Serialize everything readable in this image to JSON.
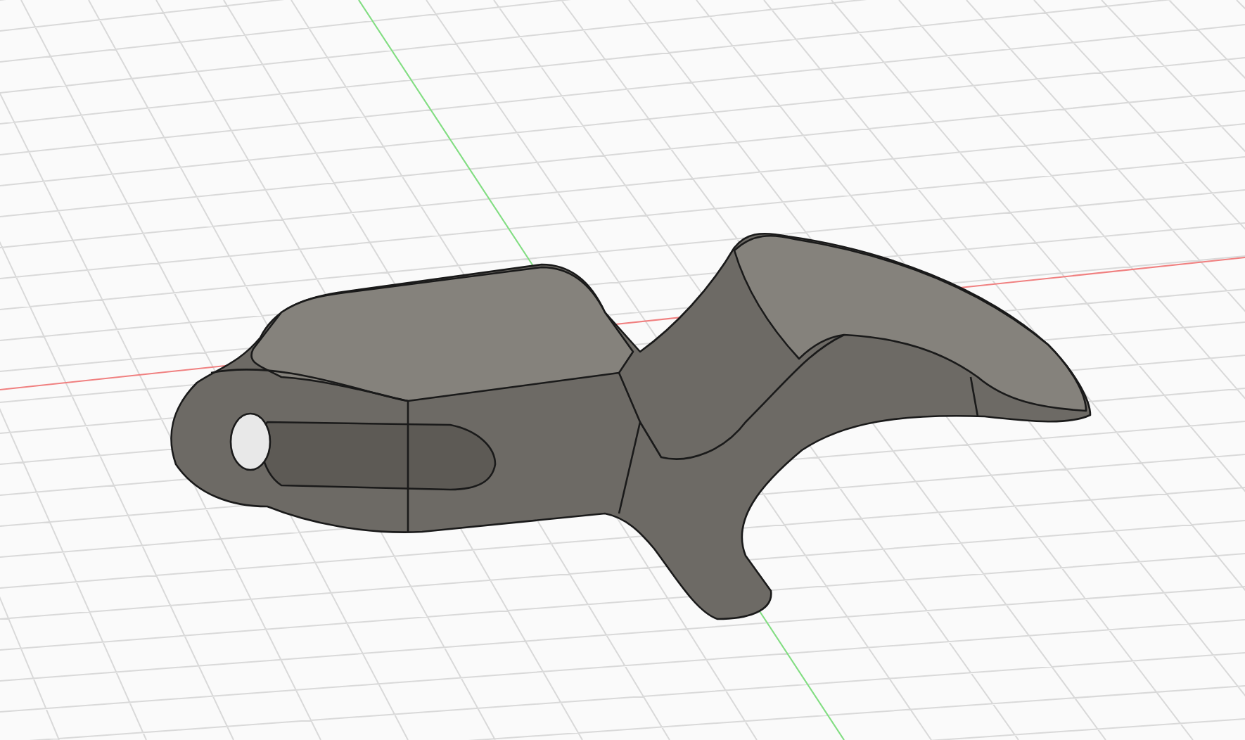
{
  "viewport": {
    "show_grid": true,
    "show_axes": true,
    "show_model": true
  }
}
